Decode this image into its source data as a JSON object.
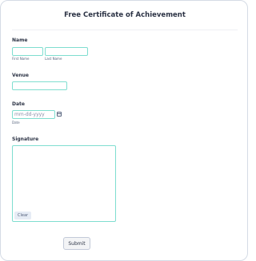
{
  "form": {
    "title": "Free Certificate of Achievement",
    "name": {
      "label": "Name",
      "first_value": "",
      "last_value": "",
      "first_sublabel": "First Name",
      "last_sublabel": "Last Name"
    },
    "venue": {
      "label": "Venue",
      "value": ""
    },
    "date": {
      "label": "Date",
      "placeholder": "mm-dd-yyyy",
      "sublabel": "Date",
      "icon": "calendar-icon"
    },
    "signature": {
      "label": "Signature",
      "clear_label": "Clear"
    },
    "submit_label": "Submit"
  },
  "colors": {
    "input_border": "#7fded0",
    "text": "#2c3345",
    "sublabel": "#57647e",
    "clear_bg": "#e6ecf5"
  }
}
